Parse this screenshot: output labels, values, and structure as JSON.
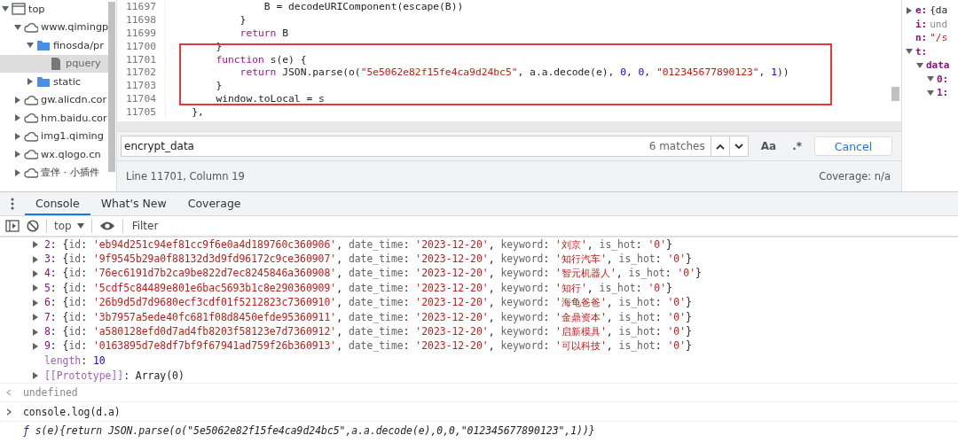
{
  "file_tree": [
    {
      "kind": "frame",
      "label": "top",
      "expanded": true,
      "selected": false,
      "children": [
        {
          "kind": "domain",
          "label": "www.qimingp",
          "expanded": true,
          "selected": false,
          "children": [
            {
              "kind": "folder",
              "label": "finosda/pr",
              "expanded": true,
              "selected": false,
              "children": [
                {
                  "kind": "file",
                  "label": "pquery",
                  "selected": true
                }
              ]
            },
            {
              "kind": "folder",
              "label": "static",
              "expanded": false,
              "selected": false
            }
          ]
        },
        {
          "kind": "domain",
          "label": "gw.alicdn.cor",
          "expanded": false,
          "selected": false
        },
        {
          "kind": "domain",
          "label": "hm.baidu.cor",
          "expanded": false,
          "selected": false
        },
        {
          "kind": "domain",
          "label": "img1.qiming",
          "expanded": false,
          "selected": false
        },
        {
          "kind": "domain",
          "label": "wx.qlogo.cn",
          "expanded": false,
          "selected": false
        },
        {
          "kind": "domain",
          "label": "壹伴 · 小插件",
          "expanded": false,
          "selected": false
        }
      ]
    }
  ],
  "code_lines": [
    {
      "number": "11697",
      "tokens": [
        {
          "kind": "plain",
          "text": "                B = decodeURIComponent(escape(B))"
        }
      ]
    },
    {
      "number": "11698",
      "tokens": [
        {
          "kind": "plain",
          "text": "            }"
        }
      ]
    },
    {
      "number": "11699",
      "tokens": [
        {
          "kind": "keyword",
          "text": "            return"
        },
        {
          "kind": "plain",
          "text": " B"
        }
      ]
    },
    {
      "number": "11700",
      "tokens": [
        {
          "kind": "plain",
          "text": "        }"
        }
      ]
    },
    {
      "number": "11701",
      "tokens": [
        {
          "kind": "keyword",
          "text": "        function"
        },
        {
          "kind": "plain",
          "text": " s(e) {"
        }
      ]
    },
    {
      "number": "11702",
      "tokens": [
        {
          "kind": "keyword",
          "text": "            return"
        },
        {
          "kind": "plain",
          "text": " JSON.parse(o("
        },
        {
          "kind": "string",
          "text": "\"5e5062e82f15fe4ca9d24bc5\""
        },
        {
          "kind": "plain",
          "text": ", a.a.decode(e), "
        },
        {
          "kind": "number",
          "text": "0"
        },
        {
          "kind": "plain",
          "text": ", "
        },
        {
          "kind": "number",
          "text": "0"
        },
        {
          "kind": "plain",
          "text": ", "
        },
        {
          "kind": "string",
          "text": "\"012345677890123\""
        },
        {
          "kind": "plain",
          "text": ", "
        },
        {
          "kind": "number",
          "text": "1"
        },
        {
          "kind": "plain",
          "text": "))"
        }
      ]
    },
    {
      "number": "11703",
      "tokens": [
        {
          "kind": "plain",
          "text": "        }"
        }
      ]
    },
    {
      "number": "11704",
      "tokens": [
        {
          "kind": "plain",
          "text": "        window.toLocal = s"
        }
      ]
    },
    {
      "number": "11705",
      "tokens": [
        {
          "kind": "plain",
          "text": "    },"
        }
      ]
    }
  ],
  "search": {
    "value": "encrypt_data",
    "matches": "6 matches",
    "case_button": "Aa",
    "regex_button": ".*",
    "cancel": "Cancel"
  },
  "status_bar": {
    "position": "Line 11701, Column 19",
    "coverage": "Coverage: n/a"
  },
  "scope": [
    {
      "key": "e:",
      "value": "{da",
      "kind": "object",
      "expanded": false
    },
    {
      "key": "i:",
      "value": "und",
      "kind": "undefined"
    },
    {
      "key": "n:",
      "value": "\"/s",
      "kind": "string"
    },
    {
      "key": "t:",
      "expanded": true,
      "children": [
        {
          "key": "data",
          "expanded": true,
          "children": [
            {
              "key": "0:",
              "expanded": true
            },
            {
              "key": "1:",
              "expanded": true
            }
          ]
        }
      ]
    }
  ],
  "drawer_tabs": [
    {
      "label": "Console",
      "selected": true
    },
    {
      "label": "What's New",
      "selected": false
    },
    {
      "label": "Coverage",
      "selected": false
    }
  ],
  "console_toolbar": {
    "context": "top",
    "filter_placeholder": "Filter"
  },
  "console_rows": [
    {
      "kind": "object",
      "expanded": false,
      "tokens": [
        {
          "kind": "index",
          "text": "2"
        },
        {
          "kind": "plain",
          "text": ": {"
        },
        {
          "kind": "key",
          "text": "id"
        },
        {
          "kind": "plain",
          "text": ": "
        },
        {
          "kind": "string",
          "text": "'eb94d251c94ef81cc9f6e0a4d189760c360906'"
        },
        {
          "kind": "plain",
          "text": ", "
        },
        {
          "kind": "key",
          "text": "date_time"
        },
        {
          "kind": "plain",
          "text": ": "
        },
        {
          "kind": "string",
          "text": "'2023-12-20'"
        },
        {
          "kind": "plain",
          "text": ", "
        },
        {
          "kind": "key",
          "text": "keyword"
        },
        {
          "kind": "plain",
          "text": ": "
        },
        {
          "kind": "string",
          "text": "'刘京'"
        },
        {
          "kind": "plain",
          "text": ", "
        },
        {
          "kind": "key",
          "text": "is_hot"
        },
        {
          "kind": "plain",
          "text": ": "
        },
        {
          "kind": "string",
          "text": "'0'"
        },
        {
          "kind": "plain",
          "text": "}"
        }
      ]
    },
    {
      "kind": "object",
      "expanded": false,
      "tokens": [
        {
          "kind": "index",
          "text": "3"
        },
        {
          "kind": "plain",
          "text": ": {"
        },
        {
          "kind": "key",
          "text": "id"
        },
        {
          "kind": "plain",
          "text": ": "
        },
        {
          "kind": "string",
          "text": "'9f9545b29a0f88132d3d9fd96172c9ce360907'"
        },
        {
          "kind": "plain",
          "text": ", "
        },
        {
          "kind": "key",
          "text": "date_time"
        },
        {
          "kind": "plain",
          "text": ": "
        },
        {
          "kind": "string",
          "text": "'2023-12-20'"
        },
        {
          "kind": "plain",
          "text": ", "
        },
        {
          "kind": "key",
          "text": "keyword"
        },
        {
          "kind": "plain",
          "text": ": "
        },
        {
          "kind": "string",
          "text": "'知行汽车'"
        },
        {
          "kind": "plain",
          "text": ", "
        },
        {
          "kind": "key",
          "text": "is_hot"
        },
        {
          "kind": "plain",
          "text": ": "
        },
        {
          "kind": "string",
          "text": "'0'"
        },
        {
          "kind": "plain",
          "text": "}"
        }
      ]
    },
    {
      "kind": "object",
      "expanded": false,
      "tokens": [
        {
          "kind": "index",
          "text": "4"
        },
        {
          "kind": "plain",
          "text": ": {"
        },
        {
          "kind": "key",
          "text": "id"
        },
        {
          "kind": "plain",
          "text": ": "
        },
        {
          "kind": "string",
          "text": "'76ec6191d7b2ca9be822d7ec8245846a360908'"
        },
        {
          "kind": "plain",
          "text": ", "
        },
        {
          "kind": "key",
          "text": "date_time"
        },
        {
          "kind": "plain",
          "text": ": "
        },
        {
          "kind": "string",
          "text": "'2023-12-20'"
        },
        {
          "kind": "plain",
          "text": ", "
        },
        {
          "kind": "key",
          "text": "keyword"
        },
        {
          "kind": "plain",
          "text": ": "
        },
        {
          "kind": "string",
          "text": "'智元机器人'"
        },
        {
          "kind": "plain",
          "text": ", "
        },
        {
          "kind": "key",
          "text": "is_hot"
        },
        {
          "kind": "plain",
          "text": ": "
        },
        {
          "kind": "string",
          "text": "'0'"
        },
        {
          "kind": "plain",
          "text": "}"
        }
      ]
    },
    {
      "kind": "object",
      "expanded": false,
      "tokens": [
        {
          "kind": "index",
          "text": "5"
        },
        {
          "kind": "plain",
          "text": ": {"
        },
        {
          "kind": "key",
          "text": "id"
        },
        {
          "kind": "plain",
          "text": ": "
        },
        {
          "kind": "string",
          "text": "'5cdf5c84489e801e6bac5693b1c8e290360909'"
        },
        {
          "kind": "plain",
          "text": ", "
        },
        {
          "kind": "key",
          "text": "date_time"
        },
        {
          "kind": "plain",
          "text": ": "
        },
        {
          "kind": "string",
          "text": "'2023-12-20'"
        },
        {
          "kind": "plain",
          "text": ", "
        },
        {
          "kind": "key",
          "text": "keyword"
        },
        {
          "kind": "plain",
          "text": ": "
        },
        {
          "kind": "string",
          "text": "'知行'"
        },
        {
          "kind": "plain",
          "text": ", "
        },
        {
          "kind": "key",
          "text": "is_hot"
        },
        {
          "kind": "plain",
          "text": ": "
        },
        {
          "kind": "string",
          "text": "'0'"
        },
        {
          "kind": "plain",
          "text": "}"
        }
      ]
    },
    {
      "kind": "object",
      "expanded": false,
      "tokens": [
        {
          "kind": "index",
          "text": "6"
        },
        {
          "kind": "plain",
          "text": ": {"
        },
        {
          "kind": "key",
          "text": "id"
        },
        {
          "kind": "plain",
          "text": ": "
        },
        {
          "kind": "string",
          "text": "'26b9d5d7d9680ecf3cdf01f5212823c7360910'"
        },
        {
          "kind": "plain",
          "text": ", "
        },
        {
          "kind": "key",
          "text": "date_time"
        },
        {
          "kind": "plain",
          "text": ": "
        },
        {
          "kind": "string",
          "text": "'2023-12-20'"
        },
        {
          "kind": "plain",
          "text": ", "
        },
        {
          "kind": "key",
          "text": "keyword"
        },
        {
          "kind": "plain",
          "text": ": "
        },
        {
          "kind": "string",
          "text": "'海龟爸爸'"
        },
        {
          "kind": "plain",
          "text": ", "
        },
        {
          "kind": "key",
          "text": "is_hot"
        },
        {
          "kind": "plain",
          "text": ": "
        },
        {
          "kind": "string",
          "text": "'0'"
        },
        {
          "kind": "plain",
          "text": "}"
        }
      ]
    },
    {
      "kind": "object",
      "expanded": false,
      "tokens": [
        {
          "kind": "index",
          "text": "7"
        },
        {
          "kind": "plain",
          "text": ": {"
        },
        {
          "kind": "key",
          "text": "id"
        },
        {
          "kind": "plain",
          "text": ": "
        },
        {
          "kind": "string",
          "text": "'3b7957a5ede40fc681f08d8450efde95360911'"
        },
        {
          "kind": "plain",
          "text": ", "
        },
        {
          "kind": "key",
          "text": "date_time"
        },
        {
          "kind": "plain",
          "text": ": "
        },
        {
          "kind": "string",
          "text": "'2023-12-20'"
        },
        {
          "kind": "plain",
          "text": ", "
        },
        {
          "kind": "key",
          "text": "keyword"
        },
        {
          "kind": "plain",
          "text": ": "
        },
        {
          "kind": "string",
          "text": "'金鼎资本'"
        },
        {
          "kind": "plain",
          "text": ", "
        },
        {
          "kind": "key",
          "text": "is_hot"
        },
        {
          "kind": "plain",
          "text": ": "
        },
        {
          "kind": "string",
          "text": "'0'"
        },
        {
          "kind": "plain",
          "text": "}"
        }
      ]
    },
    {
      "kind": "object",
      "expanded": false,
      "tokens": [
        {
          "kind": "index",
          "text": "8"
        },
        {
          "kind": "plain",
          "text": ": {"
        },
        {
          "kind": "key",
          "text": "id"
        },
        {
          "kind": "plain",
          "text": ": "
        },
        {
          "kind": "string",
          "text": "'a580128efd0d7ad4fb8203f58123e7d7360912'"
        },
        {
          "kind": "plain",
          "text": ", "
        },
        {
          "kind": "key",
          "text": "date_time"
        },
        {
          "kind": "plain",
          "text": ": "
        },
        {
          "kind": "string",
          "text": "'2023-12-20'"
        },
        {
          "kind": "plain",
          "text": ", "
        },
        {
          "kind": "key",
          "text": "keyword"
        },
        {
          "kind": "plain",
          "text": ": "
        },
        {
          "kind": "string",
          "text": "'启新模具'"
        },
        {
          "kind": "plain",
          "text": ", "
        },
        {
          "kind": "key",
          "text": "is_hot"
        },
        {
          "kind": "plain",
          "text": ": "
        },
        {
          "kind": "string",
          "text": "'0'"
        },
        {
          "kind": "plain",
          "text": "}"
        }
      ]
    },
    {
      "kind": "object",
      "expanded": false,
      "tokens": [
        {
          "kind": "index",
          "text": "9"
        },
        {
          "kind": "plain",
          "text": ": {"
        },
        {
          "kind": "key",
          "text": "id"
        },
        {
          "kind": "plain",
          "text": ": "
        },
        {
          "kind": "string",
          "text": "'0163895d7e8df7bf9f67941ad759f26b360913'"
        },
        {
          "kind": "plain",
          "text": ", "
        },
        {
          "kind": "key",
          "text": "date_time"
        },
        {
          "kind": "plain",
          "text": ": "
        },
        {
          "kind": "string",
          "text": "'2023-12-20'"
        },
        {
          "kind": "plain",
          "text": ", "
        },
        {
          "kind": "key",
          "text": "keyword"
        },
        {
          "kind": "plain",
          "text": ": "
        },
        {
          "kind": "string",
          "text": "'可以科技'"
        },
        {
          "kind": "plain",
          "text": ", "
        },
        {
          "kind": "key",
          "text": "is_hot"
        },
        {
          "kind": "plain",
          "text": ": "
        },
        {
          "kind": "string",
          "text": "'0'"
        },
        {
          "kind": "plain",
          "text": "}"
        }
      ]
    },
    {
      "kind": "property",
      "tokens": [
        {
          "kind": "property",
          "text": "length"
        },
        {
          "kind": "plain",
          "text": ": "
        },
        {
          "kind": "number",
          "text": "10"
        }
      ]
    },
    {
      "kind": "object",
      "expanded": false,
      "tokens": [
        {
          "kind": "property",
          "text": "[[Prototype]]"
        },
        {
          "kind": "plain",
          "text": ": Array(0)"
        }
      ]
    },
    {
      "kind": "result",
      "tokens": [
        {
          "kind": "undefined",
          "text": "undefined"
        }
      ]
    },
    {
      "kind": "input",
      "tokens": [
        {
          "kind": "plain",
          "text": "console.log(d.a)"
        }
      ]
    },
    {
      "kind": "function",
      "tokens": [
        {
          "kind": "function_sign",
          "text": "ƒ"
        },
        {
          "kind": "function_body",
          "text": " s(e){return JSON.parse(o(\"5e5062e82f15fe4ca9d24bc5\",a.a.decode(e),0,0,\"012345677890123\",1))}"
        }
      ]
    }
  ]
}
